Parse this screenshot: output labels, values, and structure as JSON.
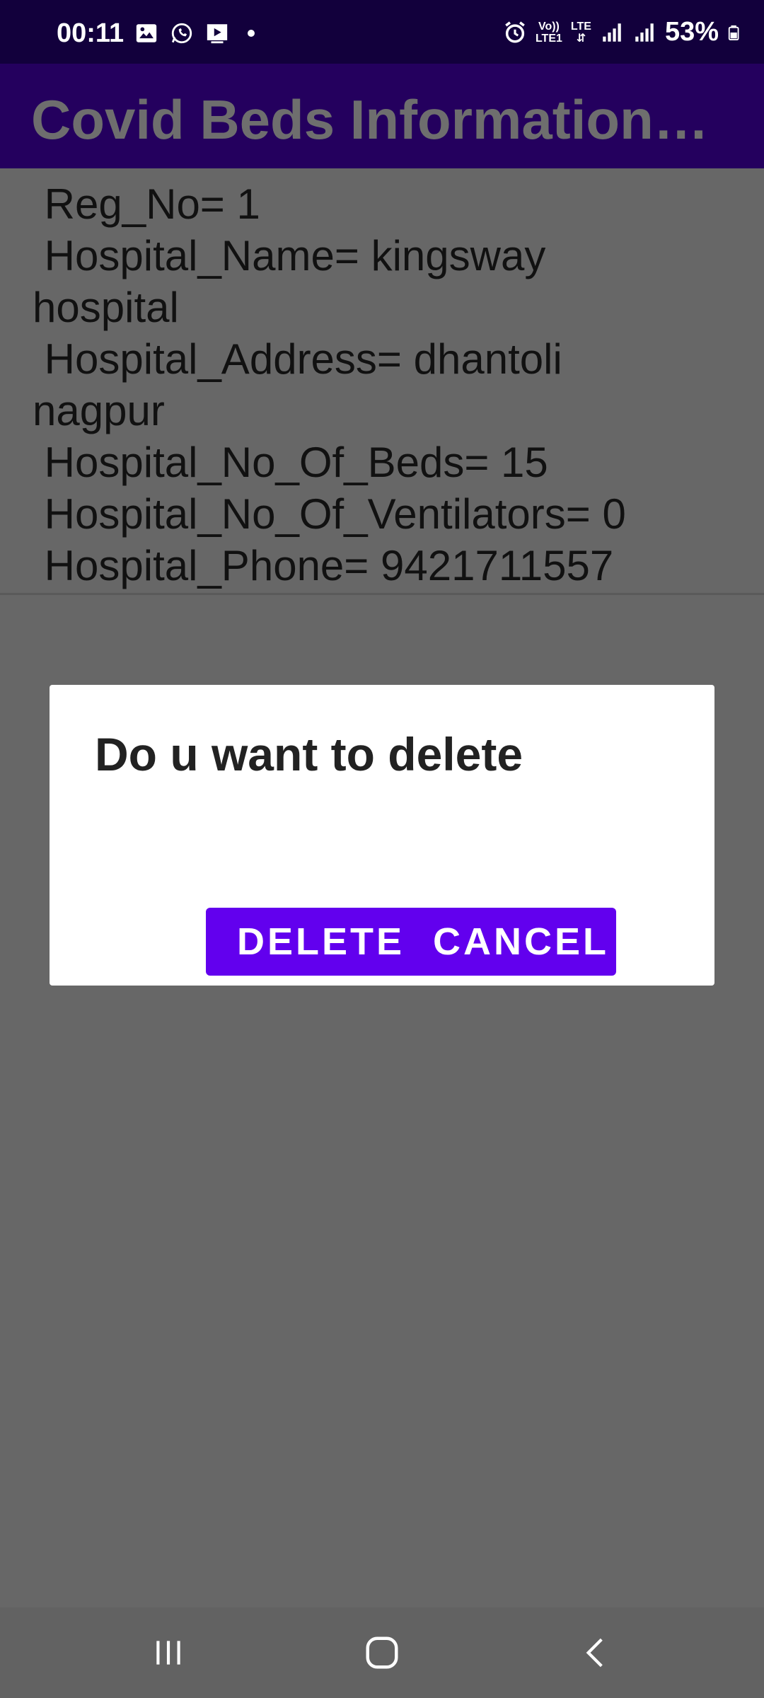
{
  "status_bar": {
    "time": "00:11",
    "net_top": "Vo))",
    "net_bottom": "LTE1",
    "lte_label": "LTE",
    "battery": "53%",
    "icons": [
      "gallery-icon",
      "whatsapp-icon",
      "media-icon",
      "dot-icon",
      "alarm-icon",
      "signal-icon",
      "battery-icon"
    ]
  },
  "app_bar": {
    "title": "Covid Beds Information…"
  },
  "record": {
    "lines": [
      " Reg_No= 1",
      " Hospital_Name= kingsway",
      "hospital",
      " Hospital_Address= dhantoli",
      "nagpur",
      " Hospital_No_Of_Beds= 15",
      " Hospital_No_Of_Ventilators= 0",
      " Hospital_Phone= 9421711557"
    ]
  },
  "dialog": {
    "title": "Do u want to delete",
    "delete_label": "DELETE",
    "cancel_label": "CANCEL",
    "accent": "#6200ee"
  },
  "nav_bar": {
    "icons": [
      "recents-icon",
      "home-icon",
      "back-icon"
    ]
  },
  "colors": {
    "status_bar": "#12003c",
    "app_bar": "#24005e",
    "scrim": "#676767"
  }
}
